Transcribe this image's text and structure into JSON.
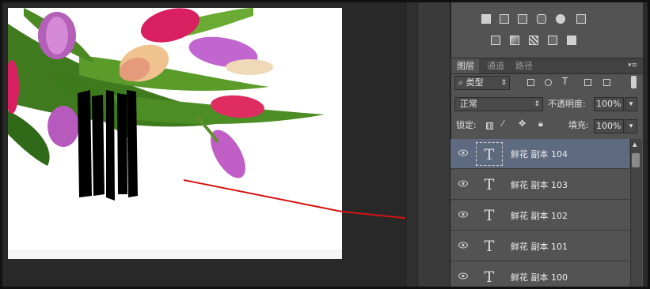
{
  "panel": {
    "tabs": [
      {
        "label": "图层",
        "active": true
      },
      {
        "label": "通道",
        "active": false
      },
      {
        "label": "路径",
        "active": false
      }
    ],
    "filter_kind": "类型",
    "blend_mode": "正常",
    "opacity_label": "不透明度:",
    "opacity_value": "100%",
    "lock_label": "锁定:",
    "fill_label": "填充:",
    "fill_value": "100%",
    "layers": [
      {
        "name": "鲜花 副本 104",
        "selected": true
      },
      {
        "name": "鲜花 副本 103",
        "selected": false
      },
      {
        "name": "鲜花 副本 102",
        "selected": false
      },
      {
        "name": "鲜花 副本 101",
        "selected": false
      },
      {
        "name": "鲜花 副本 100",
        "selected": false
      }
    ],
    "layer_thumb_glyph": "T"
  },
  "colors": {
    "panel_bg": "#535353",
    "selected_row": "#5d6a80",
    "arrow": "#d41414"
  },
  "icons": {
    "toolbar_row1": [
      "histogram-icon",
      "adjust-icon",
      "levels-icon",
      "history-icon",
      "swatches-icon",
      "grid-icon"
    ],
    "toolbar_row2": [
      "brush-preset-icon",
      "gradient-icon",
      "pattern-icon",
      "styles-icon",
      "layer-comp-icon"
    ]
  }
}
